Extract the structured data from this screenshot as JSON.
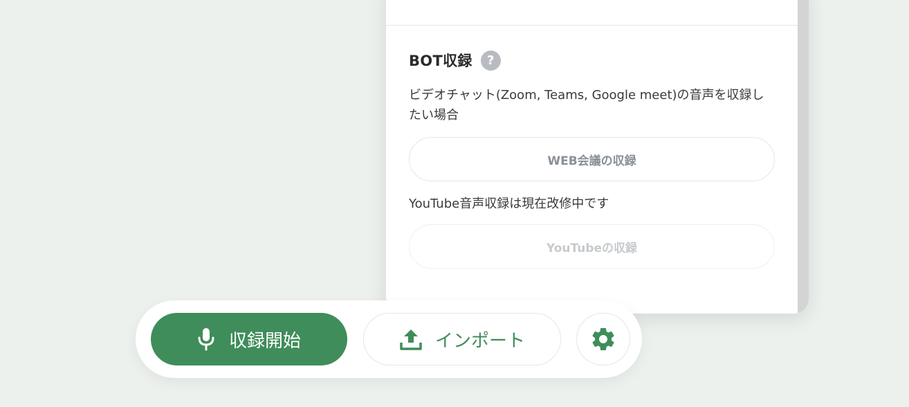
{
  "popover": {
    "section_title": "BOT収録",
    "help_icon_glyph": "?",
    "description": "ビデオチャット(Zoom, Teams, Google meet)の音声を収録したい場合",
    "web_button_label": "WEB会議の収録",
    "youtube_note": "YouTube音声収録は現在改修中です",
    "youtube_button_label": "YouTubeの収録"
  },
  "toolbar": {
    "record_label": "収録開始",
    "import_label": "インポート",
    "record_icon": "microphone-icon",
    "import_icon": "upload-icon",
    "settings_icon": "gear-icon"
  },
  "colors": {
    "accent": "#3f8d5a",
    "background": "#ecf1ed",
    "disabled_text": "#c6cacd"
  }
}
